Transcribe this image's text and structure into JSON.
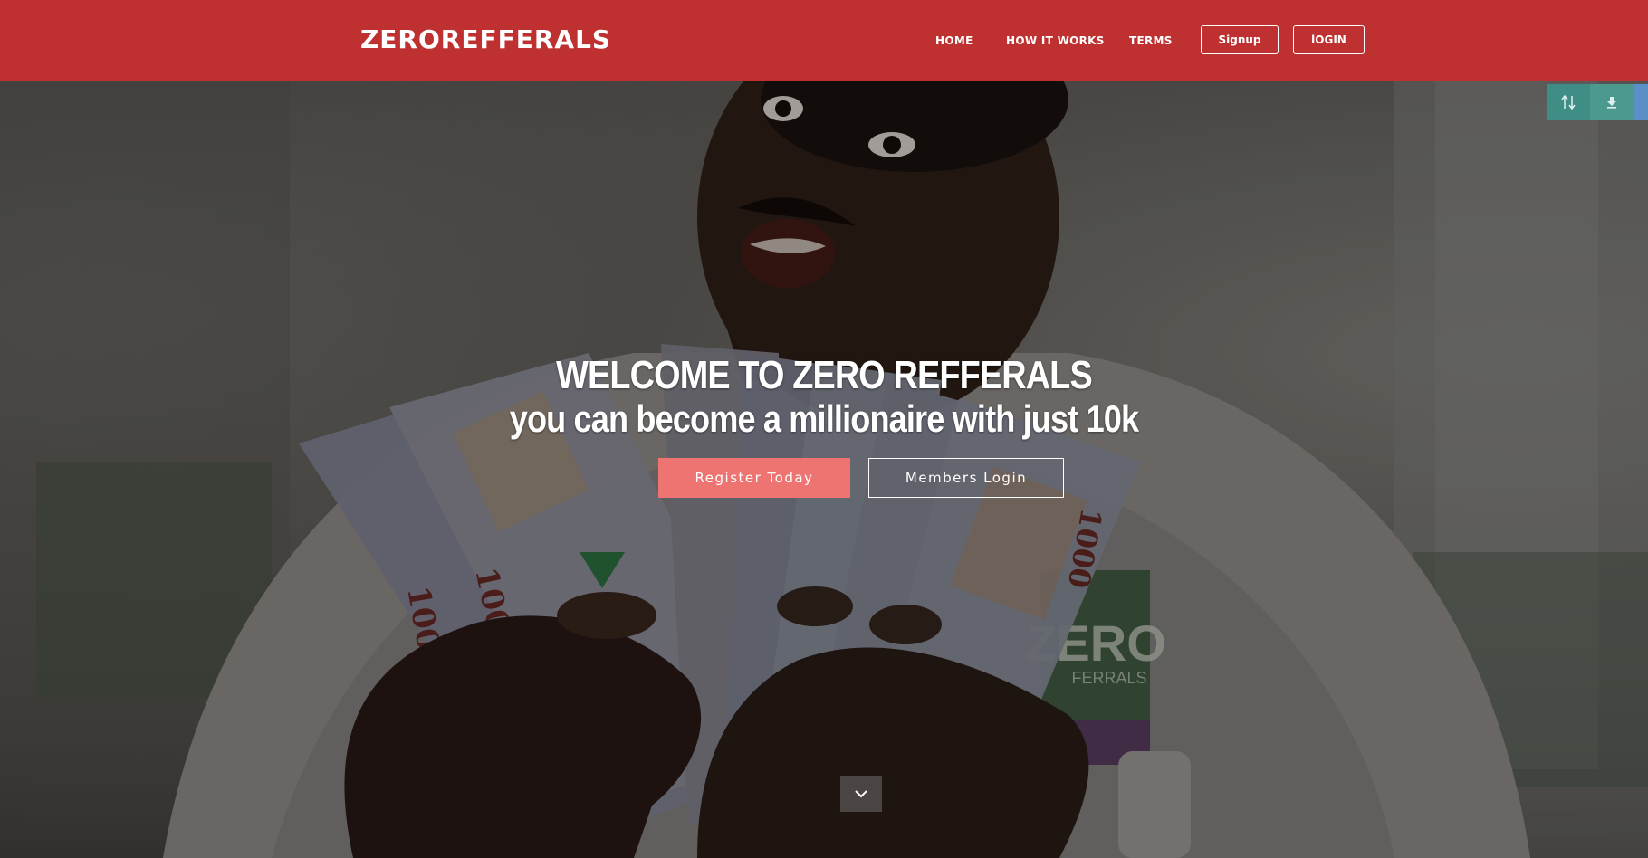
{
  "header": {
    "logo": "ZEROREFFERALS",
    "nav": [
      {
        "label": "HOME"
      },
      {
        "label": "HOW IT WORKS"
      },
      {
        "label": "TERMS"
      }
    ],
    "signup_label": "Signup",
    "login_label": "lOGIN",
    "background_color": "#bf3130"
  },
  "hero": {
    "title": "WELCOME TO ZERO REFFERALS",
    "subtitle": "you can become a millionaire with just 10k",
    "register_label": "Register Today",
    "members_login_label": "Members Login",
    "register_color": "#ee7472",
    "scroll_icon": "chevron-down-icon"
  },
  "float_tools": [
    {
      "icon": "swap-vertical-icon"
    },
    {
      "icon": "download-icon"
    }
  ],
  "photo": {
    "banknote_text": "1000",
    "shirt_logo_main": "ZERO",
    "shirt_logo_sub": "FERRALS"
  }
}
